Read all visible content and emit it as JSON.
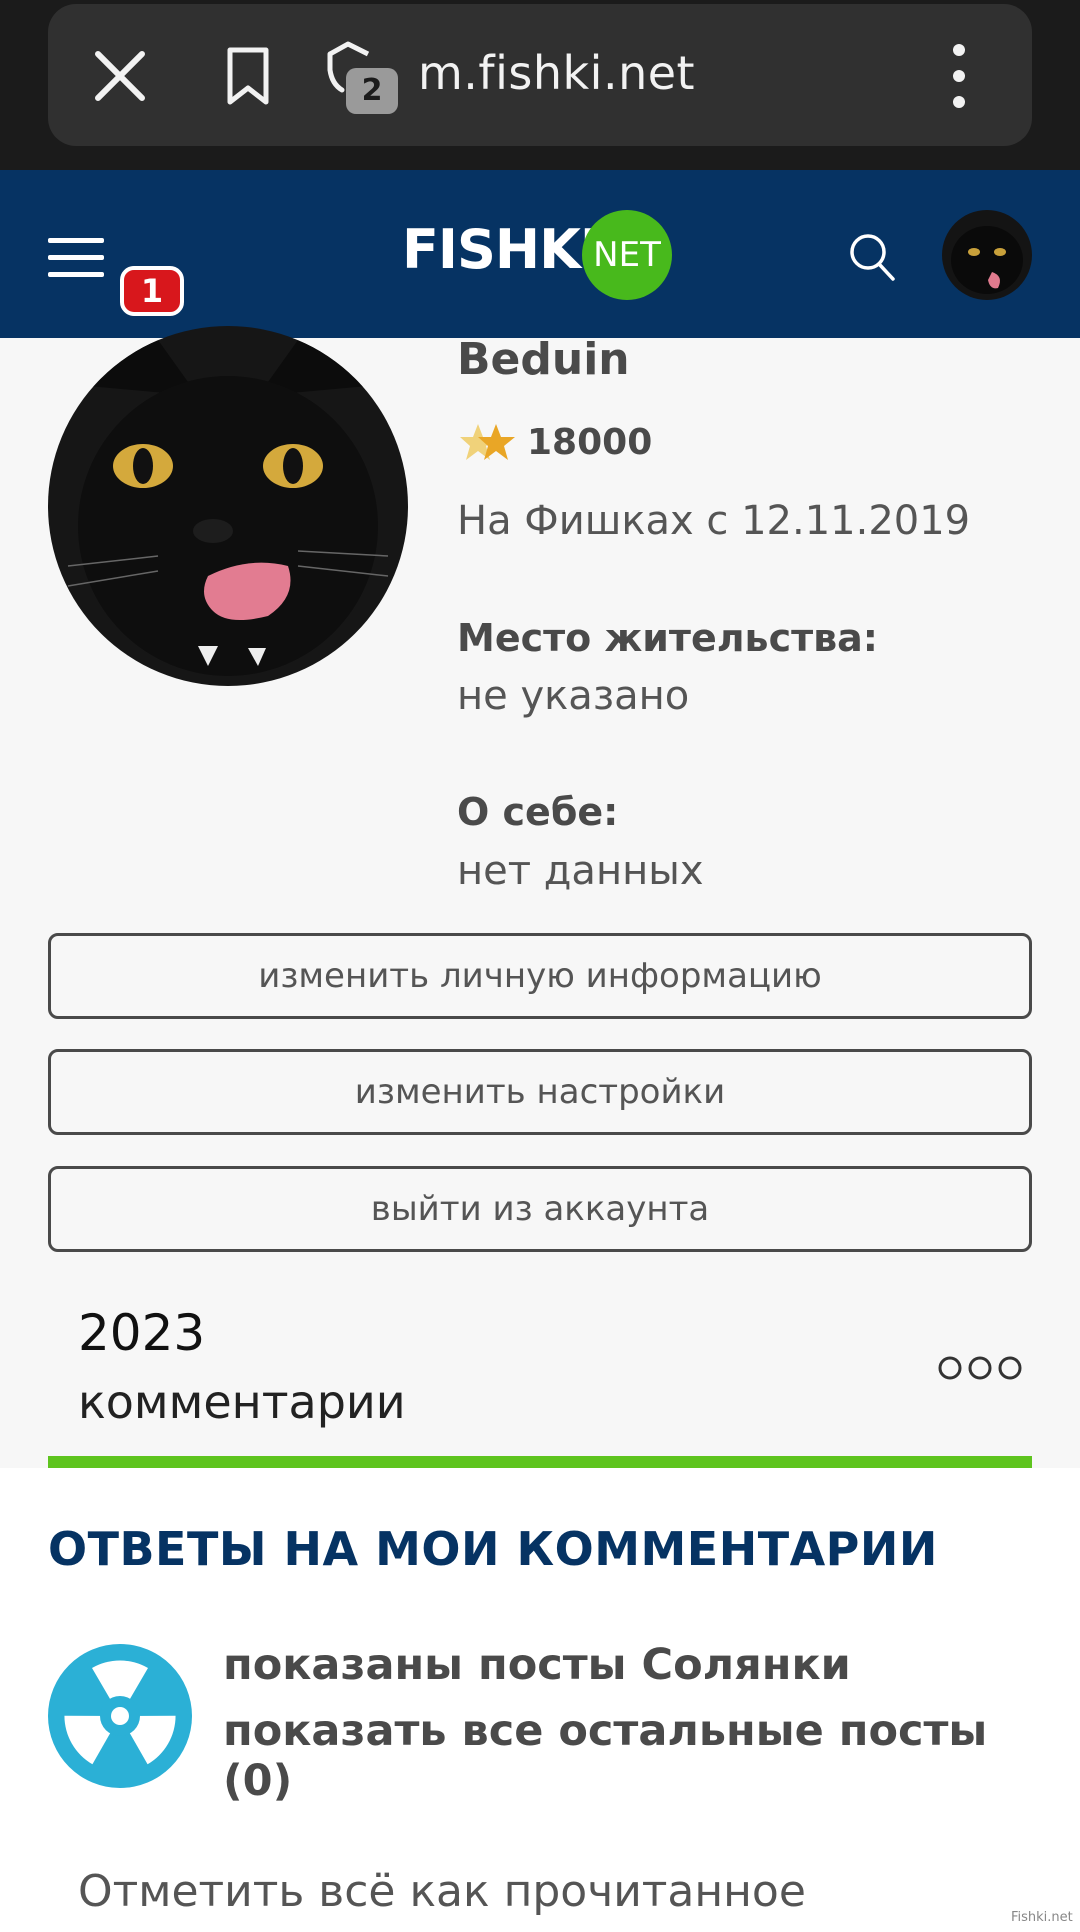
{
  "browser": {
    "url": "m.fishki.net",
    "tab_count": "2",
    "icons": [
      "close-icon",
      "bookmark-icon",
      "tabs-icon",
      "kebab-menu-icon"
    ]
  },
  "header": {
    "logo_main": "FISHKI",
    "logo_badge": "NET",
    "notification_count": "1",
    "colors": {
      "header_bg": "#063363",
      "logo_green": "#48b91c",
      "badge_red": "#d8171c"
    }
  },
  "profile": {
    "username": "Beduin",
    "rating": "18000",
    "since": "На Фишках с 12.11.2019",
    "location_label": "Место жительства:",
    "location_value": "не указано",
    "about_label": "О себе:",
    "about_value": "нет данных"
  },
  "buttons": {
    "edit_info": "изменить личную информацию",
    "edit_settings": "изменить настройки",
    "logout": "выйти из аккаунта"
  },
  "stats": {
    "count": "2023",
    "label": "комментарии",
    "accent_color": "#5ec41e"
  },
  "replies": {
    "title": "ОТВЕТЫ НА МОИ КОММЕНТАРИИ",
    "shown_posts": "показаны посты Солянки",
    "show_all": "показать все остальные посты (0)",
    "mark_read": "Отметить всё как прочитанное"
  },
  "watermark": "Fishki.net"
}
